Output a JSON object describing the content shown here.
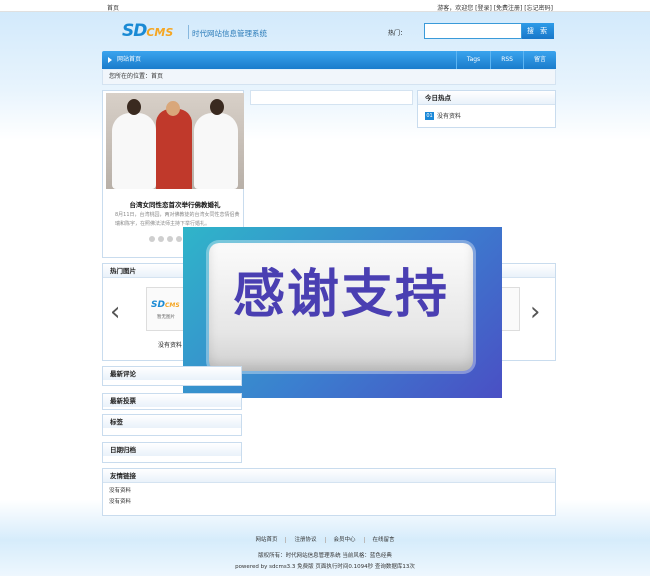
{
  "topbar": {
    "home": "首页",
    "right": "游客，欢迎您 [登录] [免费注册] [忘记密码]"
  },
  "header": {
    "logo_sd": "SD",
    "logo_cms": "CMS",
    "subtitle": "时代网站信息管理系统",
    "search_label": "热门：",
    "search_button": "搜 索"
  },
  "nav": {
    "home": "网站首页",
    "items": [
      "Tags",
      "RSS",
      "留言"
    ]
  },
  "breadcrumb": "您所在的位置：首页",
  "featured": {
    "title": "台湾女同性恋首次举行佛教婚礼",
    "desc": "8月11日，台湾桃园，两对佛教徒的台湾女同性恋情侣黄瑞和陈宇，在照佛法法师主持下举行婚礼。"
  },
  "today_hot": {
    "title": "今日热点",
    "num": "01",
    "item": "没有资料"
  },
  "hot_images": {
    "title": "热门图片",
    "thumb_logo": "SD",
    "thumb_logo_small": "CMS",
    "thumb_sub": "暂无图片",
    "caption": "没有资料",
    "prev": "‹",
    "next": "›"
  },
  "overlay": {
    "text": "感谢支持"
  },
  "sidebar": {
    "latest_comments": "最新评论",
    "latest_votes": "最新投票",
    "tags": "标签",
    "date_archive": "日期归档"
  },
  "friend_links": {
    "title": "友情链接",
    "rows": [
      "没有资料",
      "没有资料"
    ]
  },
  "footer": {
    "links": [
      "网站首页",
      "注册协议",
      "会员中心",
      "在线留言"
    ],
    "copyright": "版权所有：时代网站信息管理系统    当前风格：蓝色经典",
    "powered": "powered by sdcms3.3 免费版    页面执行时间0.1094秒    查询数据库13次"
  }
}
